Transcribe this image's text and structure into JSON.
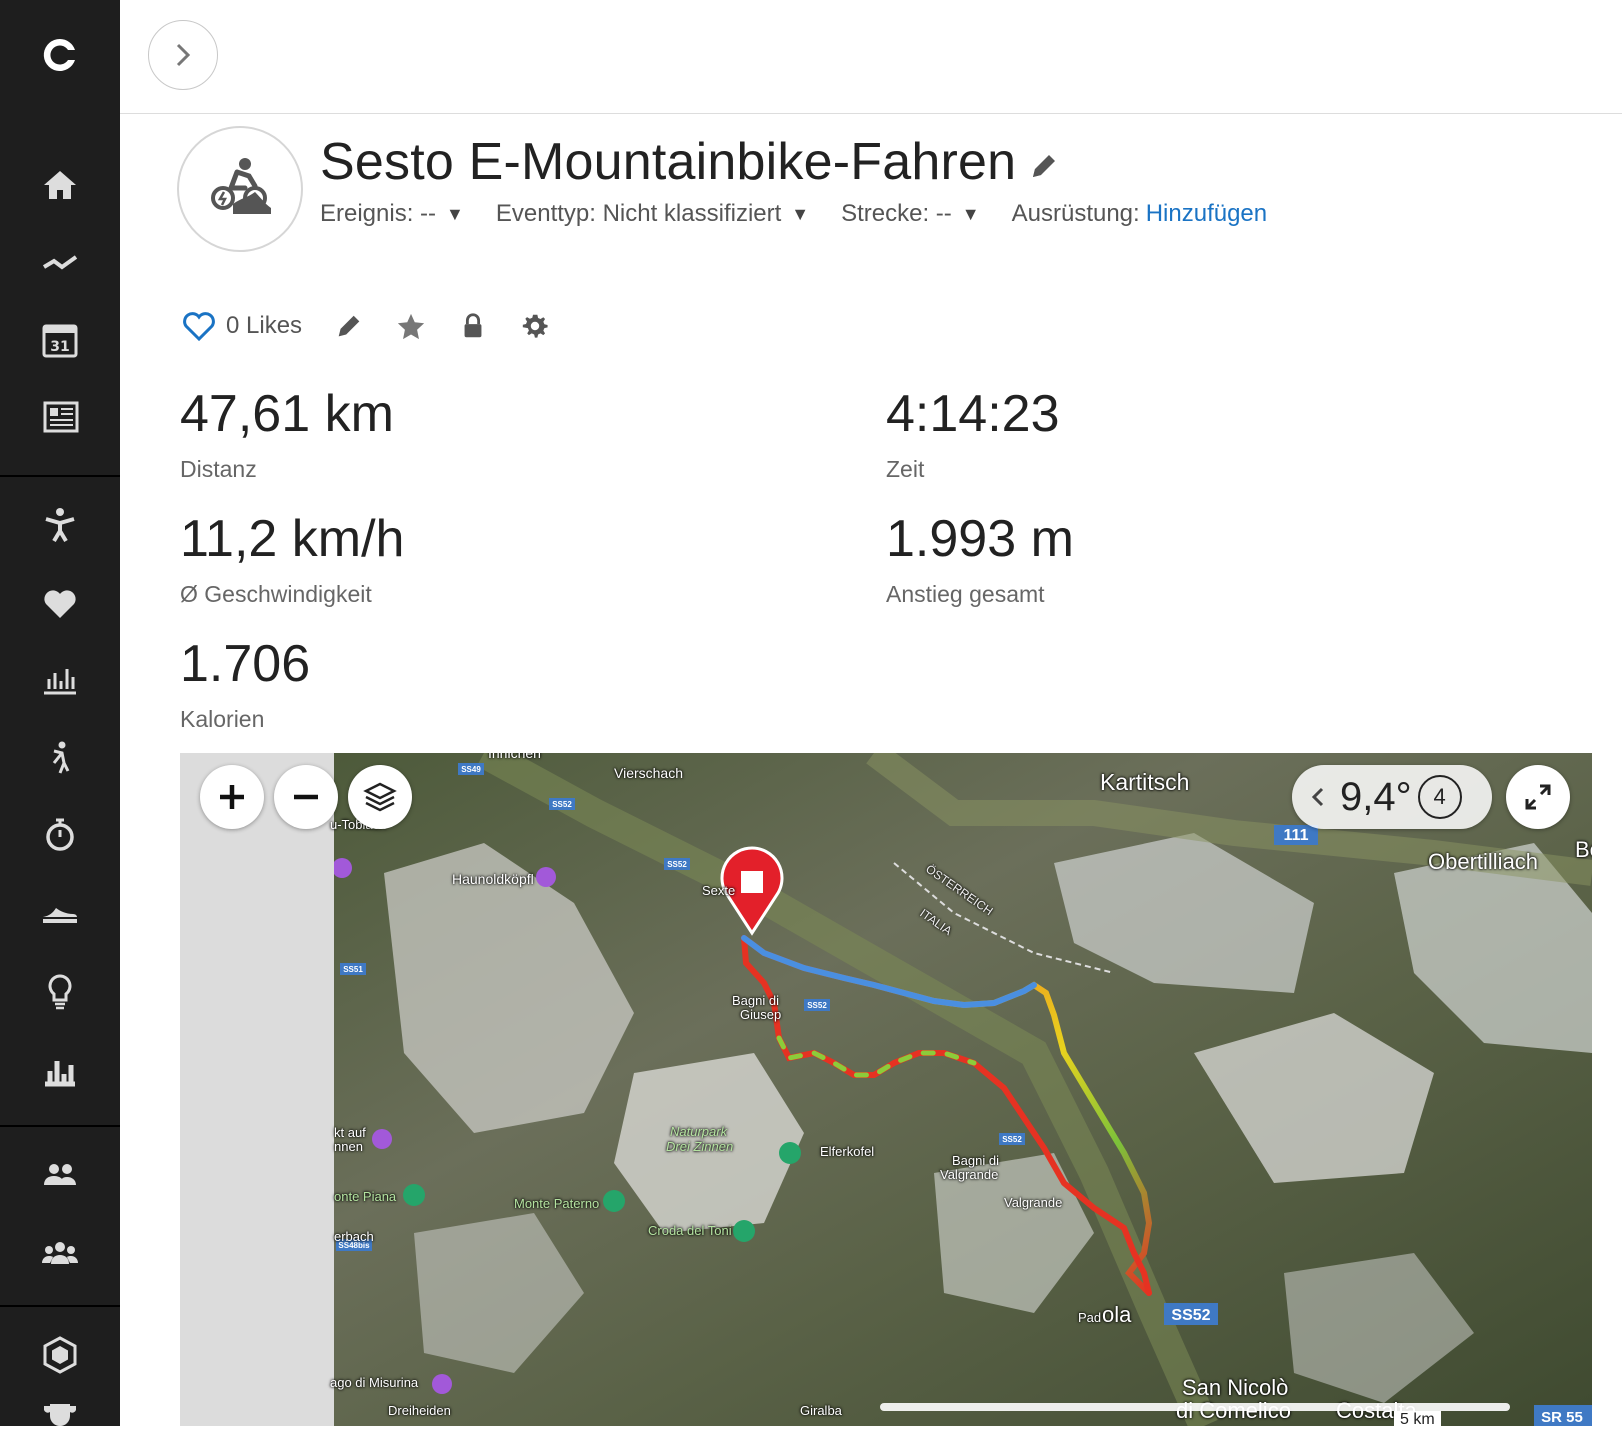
{
  "header": {
    "title": "Sesto E-Mountainbike-Fahren",
    "event_label": "Ereignis: --",
    "eventtype_label": "Eventtyp: Nicht klassifiziert",
    "course_label": "Strecke: --",
    "gear_label": "Ausrüstung:",
    "gear_link": "Hinzufügen"
  },
  "actions": {
    "likes": "0 Likes"
  },
  "stats": {
    "distance": {
      "value": "47,61 km",
      "label": "Distanz"
    },
    "time": {
      "value": "4:14:23",
      "label": "Zeit"
    },
    "speed": {
      "value": "11,2 km/h",
      "label": "Ø Geschwindigkeit"
    },
    "ascent": {
      "value": "1.993 m",
      "label": "Anstieg gesamt"
    },
    "calories": {
      "value": "1.706",
      "label": "Kalorien"
    }
  },
  "map": {
    "temperature": "9,4°",
    "weather_step": "4",
    "places": {
      "innichen": "Innichen",
      "vierschach": "Vierschach",
      "toblach": "u-Toblach",
      "kartitsch": "Kartitsch",
      "obertilliach": "Obertilliach",
      "be": "Be",
      "haunold": "Haunoldköpfl",
      "sexten": "Sexte",
      "oesterreich": "ÖSTERREICH",
      "italia": "ITALIA",
      "bagni_giusep": "Bagni di",
      "bagni_giusep2": "Giusep",
      "naturpark": "Naturpark",
      "naturpark2": "Drei Zinnen",
      "elferkofel": "Elferkofel",
      "bagni_valgrande": "Bagni di",
      "bagni_valgrande2": "Valgrande",
      "valgrande": "Valgrande",
      "monte_piana": "onte Piana",
      "monte_paterno": "Monte Paterno",
      "croda": "Croda del Toni",
      "kt_auf": "kt auf",
      "nnen": "nnen",
      "erbach": "erbach",
      "padola": "ola",
      "pad": "Pad",
      "san_nicolo": "San Nicolò",
      "comelico": "di Comelico",
      "misurina": "ago di Misurina",
      "dreiheiden": "Dreiheiden",
      "giralba": "Giralba",
      "costalta": "Costalta",
      "scale": "5 km"
    },
    "roads": {
      "ss49": "SS49",
      "ss52a": "SS52",
      "ss52b": "SS52",
      "ss52c": "SS52",
      "ss52d": "SS52",
      "ss52big": "SS52",
      "ss51": "SS51",
      "ss48bis": "SS48bis",
      "r111": "111",
      "sr": "SR 55"
    }
  },
  "colors": {
    "sidebar_bg": "#1e1e1e",
    "link": "#1a73c4",
    "pin": "#e3202a",
    "road_badge": "#3f79c4"
  }
}
